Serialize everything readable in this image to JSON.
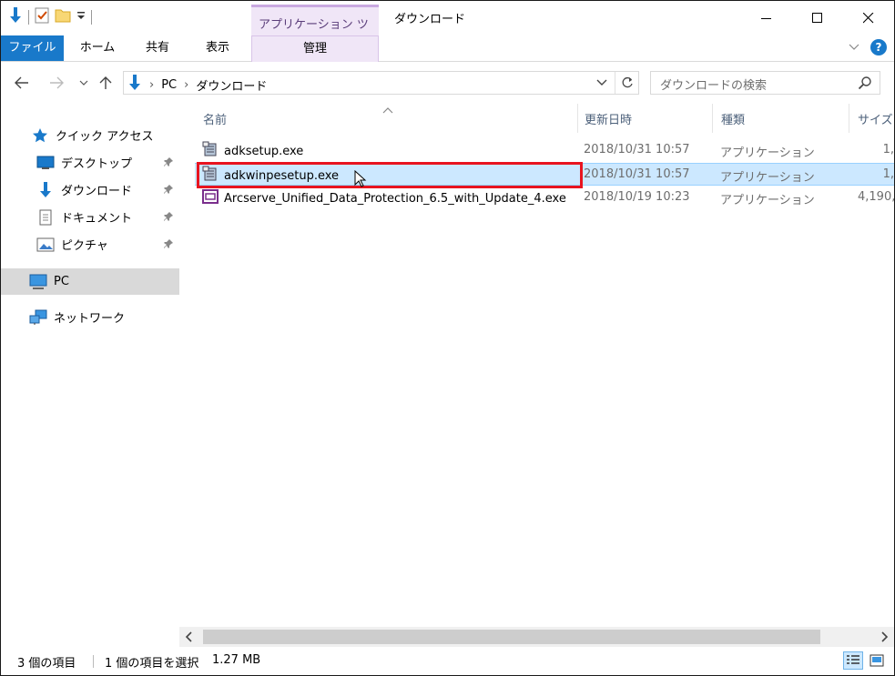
{
  "window": {
    "title": "ダウンロード",
    "context_tab_header": "アプリケーション ツール"
  },
  "ribbon": {
    "tabs": {
      "file": "ファイル",
      "home": "ホーム",
      "share": "共有",
      "view": "表示",
      "manage": "管理"
    }
  },
  "address": {
    "crumbs": [
      "PC",
      "ダウンロード"
    ]
  },
  "search": {
    "placeholder": "ダウンロードの検索"
  },
  "navpane": {
    "items": [
      {
        "label": "クイック アクセス",
        "icon": "star-icon",
        "pinned": false
      },
      {
        "label": "デスクトップ",
        "icon": "desktop-icon",
        "pinned": true
      },
      {
        "label": "ダウンロード",
        "icon": "download-icon",
        "pinned": true
      },
      {
        "label": "ドキュメント",
        "icon": "document-icon",
        "pinned": true
      },
      {
        "label": "ピクチャ",
        "icon": "picture-icon",
        "pinned": true
      },
      {
        "label": "PC",
        "icon": "pc-icon",
        "pinned": false,
        "selected": true
      },
      {
        "label": "ネットワーク",
        "icon": "network-icon",
        "pinned": false
      }
    ]
  },
  "filelist": {
    "columns": {
      "name": "名前",
      "date": "更新日時",
      "type": "種類",
      "size": "サイズ"
    },
    "rows": [
      {
        "name": "adksetup.exe",
        "date": "2018/10/31 10:57",
        "type": "アプリケーション",
        "size": "1,",
        "icon": "installer-icon",
        "selected": false
      },
      {
        "name": "adkwinpesetup.exe",
        "date": "2018/10/31 10:57",
        "type": "アプリケーション",
        "size": "1,",
        "icon": "installer-icon",
        "selected": true
      },
      {
        "name": "Arcserve_Unified_Data_Protection_6.5_with_Update_4.exe",
        "date": "2018/10/19 10:23",
        "type": "アプリケーション",
        "size": "4,190,",
        "icon": "app-window-icon",
        "selected": false
      }
    ]
  },
  "status": {
    "item_count": "3 個の項目",
    "selection": "1 個の項目を選択",
    "selection_size": "1.27 MB"
  },
  "colors": {
    "accent": "#1979ca",
    "selection_bg": "#cce8ff",
    "context_tab": "#f0e6f7",
    "highlight": "#e8141f"
  }
}
